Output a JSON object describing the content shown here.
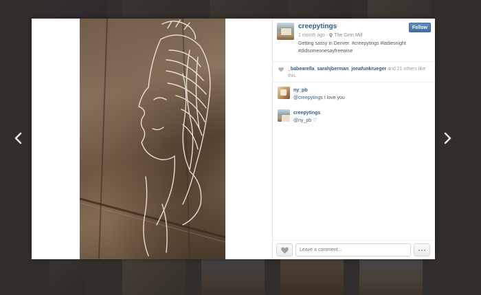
{
  "post": {
    "username": "creepytings",
    "time_ago": "1 month ago",
    "separator": "·",
    "location": "The Ginn Mill",
    "caption": "Getting sassy in Denver. #creepytings #ladiesnight #didsomeonesayfreewine",
    "follow_label": "Follow"
  },
  "likes": {
    "users": [
      "_babearella",
      "sarahjberman",
      "jonafunkrueger"
    ],
    "separators": [
      ", ",
      ", "
    ],
    "count_text": " and 21 others like this."
  },
  "comments": [
    {
      "user": "ny_pb",
      "mention": "@creepytings",
      "text": " I love you"
    },
    {
      "user": "creepytings",
      "mention": "@ny_pb",
      "text": " ♡"
    }
  ],
  "footer": {
    "comment_placeholder": "Leave a comment..."
  },
  "icons": {
    "nav_prev": "chevron-left-icon",
    "nav_next": "chevron-right-icon",
    "location": "location-pin-icon",
    "likes": "heart-icon",
    "like_button": "heart-icon",
    "more": "ellipsis-icon"
  },
  "colors": {
    "link": "#2f5d87",
    "follow_button": "#4a7bab",
    "background": "#3f3b38"
  }
}
